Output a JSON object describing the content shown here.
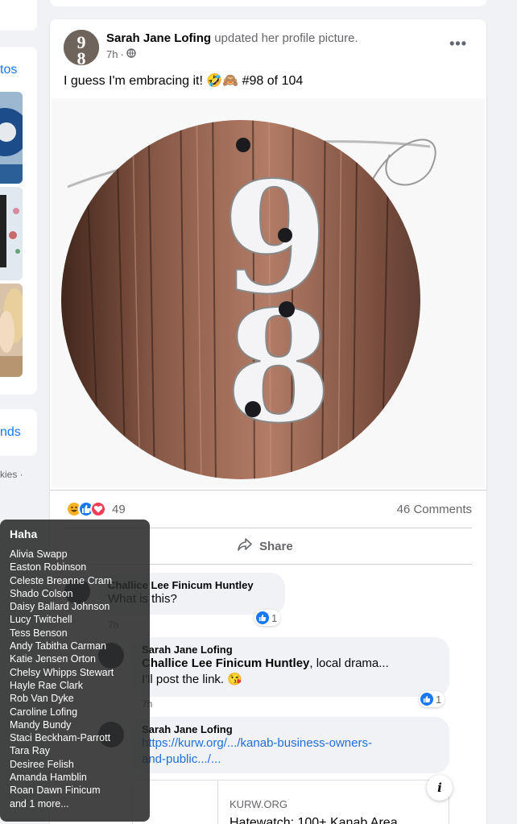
{
  "left_column": {
    "photos_link": "tos",
    "friends_link": "nds",
    "footer": "kies ·"
  },
  "post": {
    "author": "Sarah Jane Lofing",
    "action": "updated her profile picture.",
    "time": "7h",
    "privacy_icon": "globe-icon",
    "more_label": "•••",
    "caption": "I guess I'm embracing it! 🤣🙈 #98 of 104",
    "image_digits": [
      "9",
      "8"
    ],
    "reaction_count": "49",
    "reaction_icons": [
      "haha-icon",
      "like-icon",
      "love-icon"
    ],
    "comments_count": "46 Comments",
    "share_label": "Share"
  },
  "comments": [
    {
      "author": "Challice Lee Finicum Huntley",
      "text": "What is this?",
      "time": "7h",
      "likes": "1"
    },
    {
      "author": "Sarah Jane Lofing",
      "mention": "Challice Lee Finicum Huntley",
      "text_after": ", local drama...",
      "text_line2": "I'll post the link. 😘",
      "time": "7h",
      "likes": "1"
    },
    {
      "author": "Sarah Jane Lofing",
      "link_line1": "https://kurw.org/.../kanab-business-owners-",
      "link_line2": "and-public.../..."
    }
  ],
  "link_preview": {
    "domain": "KURW.ORG",
    "title": "Hatewatch: 100+ Kanab Area",
    "info_label": "i"
  },
  "tooltip": {
    "title": "Haha",
    "names": [
      "Alivia Swapp",
      "Easton Robinson",
      "Celeste Breanne Cram",
      "Shado Colson",
      "Daisy Ballard Johnson",
      "Lucy Twitchell",
      "Tess Benson",
      "Andy Tabitha Carman",
      "Katie Jensen Orton",
      "Chelsy Whipps Stewart",
      "Hayle Rae Clark",
      "Rob Van Dyke",
      "Caroline Lofing",
      "Mandy Bundy",
      "Staci Beckham-Parrott",
      "Tara Ray",
      "Desiree Felish",
      "Amanda Hamblin",
      "Roan Dawn Finicum",
      "and 1 more..."
    ]
  },
  "colors": {
    "accent": "#1877f2",
    "background": "#f0f2f5",
    "love": "#f33e58",
    "haha": "#f7b125"
  }
}
